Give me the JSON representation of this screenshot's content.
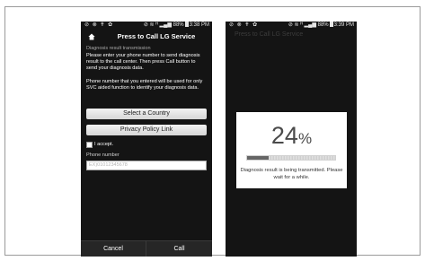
{
  "left_screen": {
    "status": {
      "left_icons": "⊘ ⊗ ✝ ✿",
      "signal": "⊘ ≋ ᴴ ▂▄▆",
      "battery_pct": "88%",
      "time": "3:38 PM"
    },
    "title": "Press to Call LG Service",
    "section_label": "Diagnosis result transmission",
    "para1": "Please enter your phone number to send diagnosis result to the call center. Then press Call button to send your diagnosis data.",
    "para2": "Phone number that you entered will be used for only SVC aided function to identify your diagnosis data.",
    "btn_country": "Select a Country",
    "btn_privacy": "Privacy Policy Link",
    "accept_label": "I accept.",
    "phone_label": "Phone number",
    "phone_placeholder": "EX)01012345678",
    "cancel_label": "Cancel",
    "call_label": "Call"
  },
  "right_screen": {
    "status": {
      "left_icons": "⊘ ⊗ ✝ ✿",
      "signal": "⊘ ≋ ᴴ ▂▄▆",
      "battery_pct": "88%",
      "time": "3:39 PM"
    },
    "background_title": "Press to Call LG Service",
    "dialog": {
      "percent_value": "24",
      "percent_sign": "%",
      "progress": 0.24,
      "message": "Diagnosis result is being transmitted. Please wait for a while."
    }
  },
  "colors": {
    "screen_bg": "#141414",
    "button_bg": "#e6e6e6",
    "progress_fill": "#666666"
  }
}
